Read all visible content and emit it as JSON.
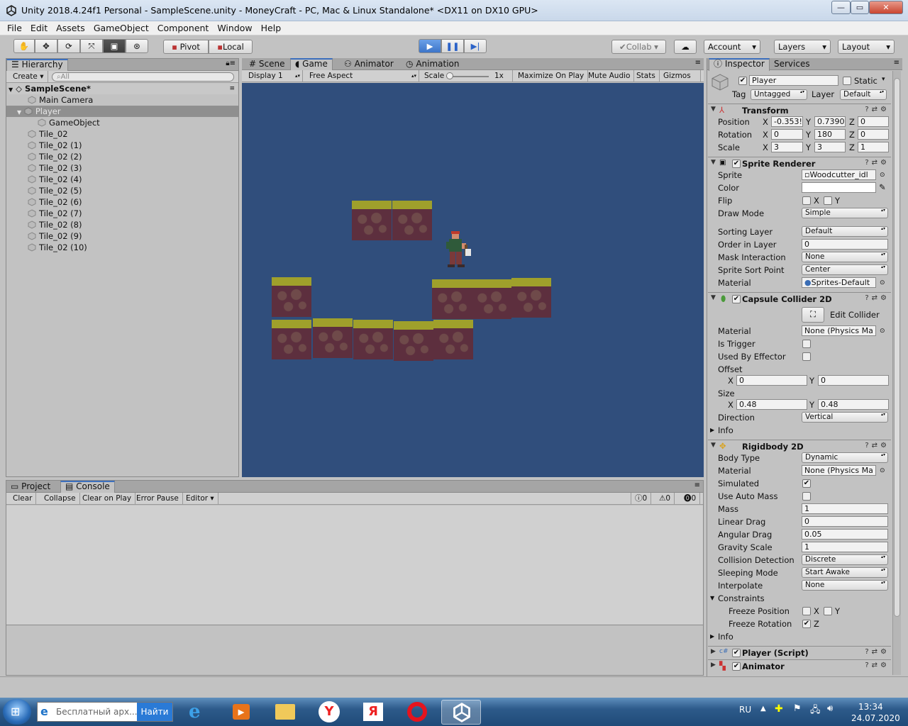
{
  "window": {
    "title": "Unity 2018.4.24f1 Personal - SampleScene.unity - MoneyCraft - PC, Mac & Linux Standalone* <DX11 on DX10 GPU>",
    "min": "—",
    "max": "▭",
    "close": "✕"
  },
  "menu": [
    "File",
    "Edit",
    "Assets",
    "GameObject",
    "Component",
    "Window",
    "Help"
  ],
  "toolbar": {
    "pivot": "Pivot",
    "local": "Local",
    "collab": "Collab",
    "account": "Account",
    "layers": "Layers",
    "layout": "Layout"
  },
  "hierarchy": {
    "tab": "Hierarchy",
    "create": "Create",
    "search_placeholder": "All",
    "scene": "SampleScene*",
    "items": [
      "Main Camera",
      "Player",
      "GameObject",
      "Tile_02",
      "Tile_02 (1)",
      "Tile_02 (2)",
      "Tile_02 (3)",
      "Tile_02 (4)",
      "Tile_02 (5)",
      "Tile_02 (6)",
      "Tile_02 (7)",
      "Tile_02 (8)",
      "Tile_02 (9)",
      "Tile_02 (10)"
    ]
  },
  "center": {
    "tabs": [
      "Scene",
      "Game",
      "Animator",
      "Animation"
    ],
    "display": "Display 1",
    "aspect": "Free Aspect",
    "scale_label": "Scale",
    "scale_value": "1x",
    "maximize": "Maximize On Play",
    "mute": "Mute Audio",
    "stats": "Stats",
    "gizmos": "Gizmos",
    "game_bg": "#304e7c"
  },
  "console": {
    "tabs": [
      "Project",
      "Console"
    ],
    "buttons": [
      "Clear",
      "Collapse",
      "Clear on Play",
      "Error Pause",
      "Editor"
    ],
    "counts": [
      "0",
      "0",
      "0"
    ]
  },
  "inspector": {
    "tabs": [
      "Inspector",
      "Services"
    ],
    "name": "Player",
    "static": "Static",
    "tag_label": "Tag",
    "tag": "Untagged",
    "layer_label": "Layer",
    "layer": "Default",
    "transform": {
      "title": "Transform",
      "labels": [
        "Position",
        "Rotation",
        "Scale"
      ],
      "axes": [
        "X",
        "Y",
        "Z"
      ],
      "values": [
        [
          "-0.353!",
          "0.7390",
          "0"
        ],
        [
          "0",
          "180",
          "0"
        ],
        [
          "3",
          "3",
          "1"
        ]
      ]
    },
    "sprite_renderer": {
      "title": "Sprite Renderer",
      "sprite_label": "Sprite",
      "sprite": "Woodcutter_idl",
      "color_label": "Color",
      "flip_label": "Flip",
      "flip_x": "X",
      "flip_y": "Y",
      "draw_mode_label": "Draw Mode",
      "draw_mode": "Simple",
      "sorting_layer_label": "Sorting Layer",
      "sorting_layer": "Default",
      "order_label": "Order in Layer",
      "order": "0",
      "mask_label": "Mask Interaction",
      "mask": "None",
      "sort_point_label": "Sprite Sort Point",
      "sort_point": "Center",
      "material_label": "Material",
      "material": "Sprites-Default"
    },
    "capsule": {
      "title": "Capsule Collider 2D",
      "edit": "Edit Collider",
      "material_label": "Material",
      "material": "None (Physics Ma",
      "trigger_label": "Is Trigger",
      "effector_label": "Used By Effector",
      "offset_label": "Offset",
      "offset_x": "0",
      "offset_y": "0",
      "size_label": "Size",
      "size_x": "0.48",
      "size_y": "0.48",
      "direction_label": "Direction",
      "direction": "Vertical",
      "info": "Info"
    },
    "rigidbody": {
      "title": "Rigidbody 2D",
      "body_type_label": "Body Type",
      "body_type": "Dynamic",
      "material_label": "Material",
      "material": "None (Physics Ma",
      "simulated_label": "Simulated",
      "auto_mass_label": "Use Auto Mass",
      "mass_label": "Mass",
      "mass": "1",
      "linear_label": "Linear Drag",
      "linear": "0",
      "angular_label": "Angular Drag",
      "angular": "0.05",
      "gravity_label": "Gravity Scale",
      "gravity": "1",
      "collision_label": "Collision Detection",
      "collision": "Discrete",
      "sleep_label": "Sleeping Mode",
      "sleep": "Start Awake",
      "interp_label": "Interpolate",
      "interp": "None",
      "constraints_label": "Constraints",
      "freeze_pos_label": "Freeze Position",
      "freeze_rot_label": "Freeze Rotation",
      "x": "X",
      "y": "Y",
      "z": "Z",
      "info": "Info"
    },
    "player_script": "Player (Script)",
    "animator": "Animator"
  },
  "taskbar": {
    "search_text": "Бесплатный арх...",
    "search_button": "Найти",
    "lang": "RU",
    "time": "13:34",
    "date": "24.07.2020"
  }
}
